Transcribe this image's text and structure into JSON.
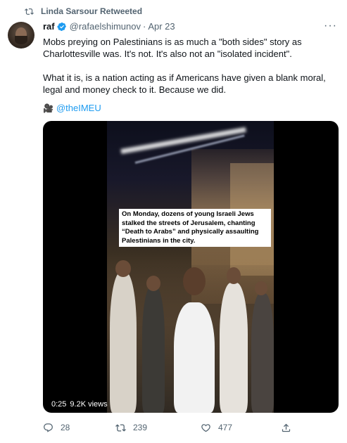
{
  "retweet": {
    "label": "Linda Sarsour Retweeted",
    "icon": "retweet-icon"
  },
  "tweet": {
    "name": "raf",
    "verified": true,
    "handle": "@rafaelshimunov",
    "separator": "·",
    "date": "Apr 23",
    "more": "···",
    "text_p1": "Mobs preying on Palestinians is as much a \"both sides\" story as Charlottesville was. It's not. It's also not an \"isolated incident\".",
    "text_p2": "What it is, is a nation acting as if Americans have given a blank moral, legal and money check to it. Because we did.",
    "attribution": {
      "icon": "video-camera-icon",
      "handle": "@theIMEU"
    },
    "media": {
      "caption": "On Monday, dozens of young Israeli Jews stalked the streets of Jerusalem, chanting “Death to Arabs” and physically assaulting Palestinians in the city.",
      "duration": "0:25",
      "views": "9.2K views"
    },
    "actions": {
      "replies": "28",
      "retweets": "239",
      "likes": "477"
    }
  },
  "colors": {
    "accent": "#1d9bf0",
    "muted": "#536471",
    "text": "#0f1419"
  }
}
